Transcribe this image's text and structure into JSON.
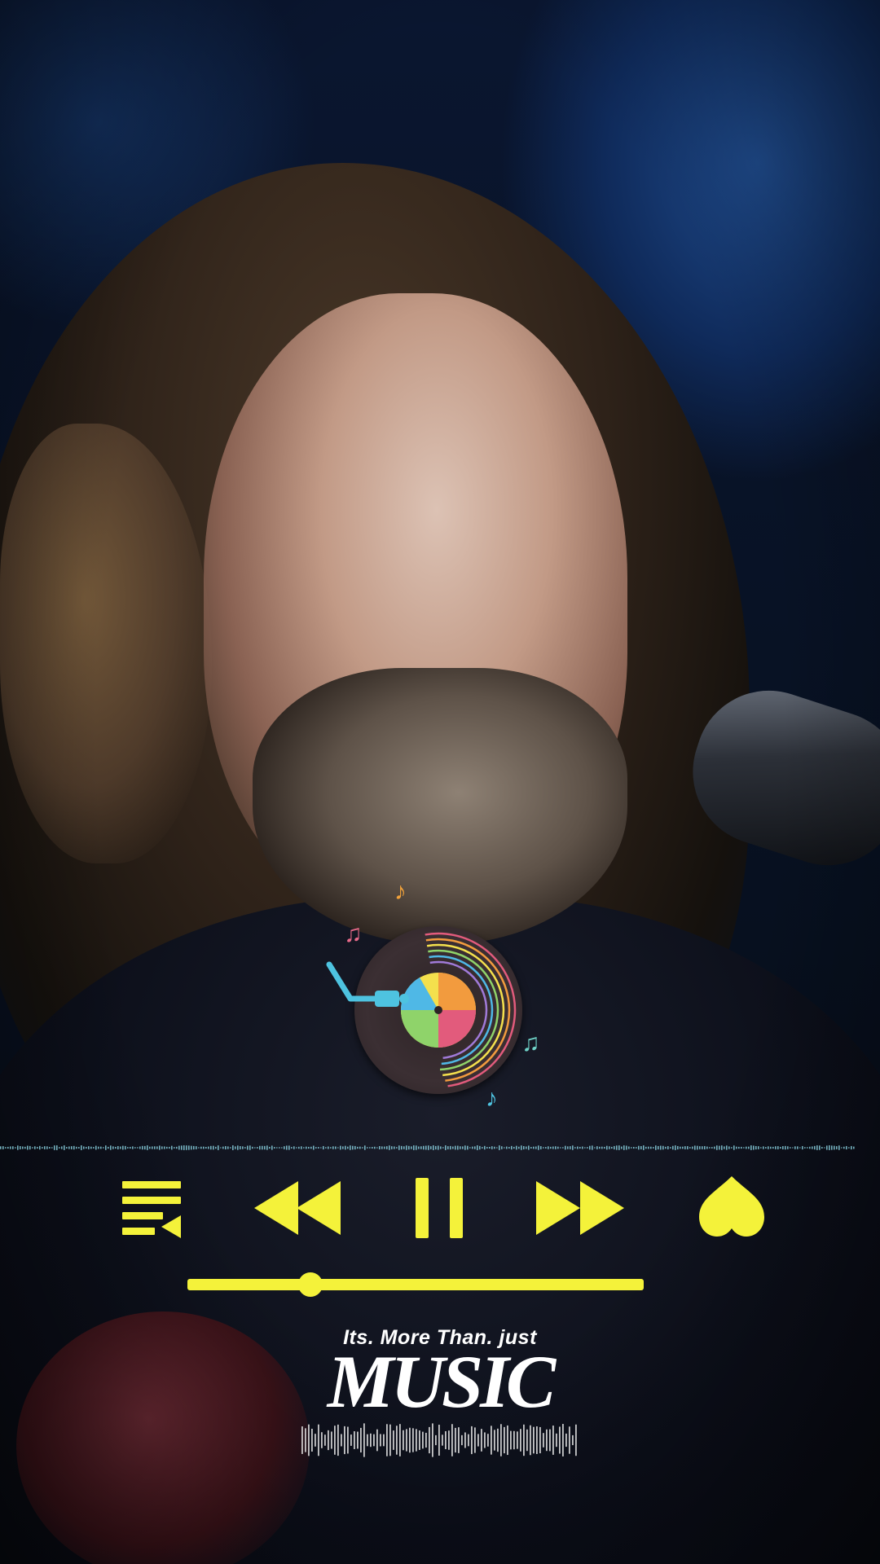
{
  "colors": {
    "accent": "#f4f23a",
    "text": "#ffffff",
    "wave": "#8fd9e8"
  },
  "player": {
    "progress_fraction": 0.27,
    "controls": [
      {
        "name": "playlist-icon"
      },
      {
        "name": "rewind-icon"
      },
      {
        "name": "pause-icon"
      },
      {
        "name": "fast-forward-icon"
      },
      {
        "name": "heart-icon"
      }
    ]
  },
  "branding": {
    "tagline": "Its. More Than.  just",
    "title": "MUSIC"
  }
}
